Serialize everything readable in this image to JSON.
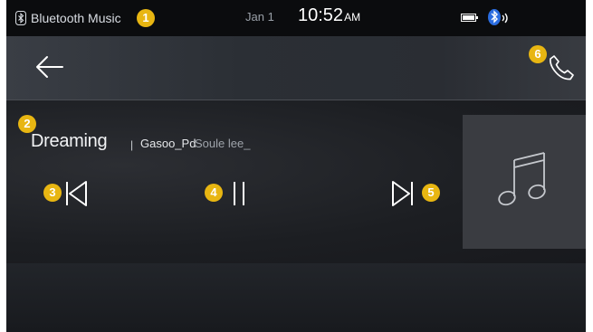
{
  "status_bar": {
    "app_label": "Bluetooth Music",
    "date": "Jan 1",
    "time": "10:52",
    "ampm": "AM",
    "icons": [
      "bluetooth-icon",
      "battery-icon",
      "bluetooth-audio-icon"
    ]
  },
  "header": {
    "icons": [
      "back-arrow-icon",
      "phone-icon"
    ]
  },
  "track": {
    "title": "Dreaming",
    "separator": "|",
    "artist": "Gasoo_Pd",
    "album": "Soule lee_"
  },
  "controls": {
    "icons": [
      "previous-track-icon",
      "pause-icon",
      "next-track-icon"
    ]
  },
  "album_art": {
    "icon": "music-note-icon"
  },
  "annotations": [
    "1",
    "2",
    "3",
    "4",
    "5",
    "6"
  ],
  "colors": {
    "badge": "#e8b612",
    "status_bar_bg": "#0b0c0e",
    "header_bg": "#2b2f35",
    "player_bg": "#1c1e22",
    "art_bg": "#3a3c41",
    "bt_audio_accent": "#2b6de0"
  }
}
